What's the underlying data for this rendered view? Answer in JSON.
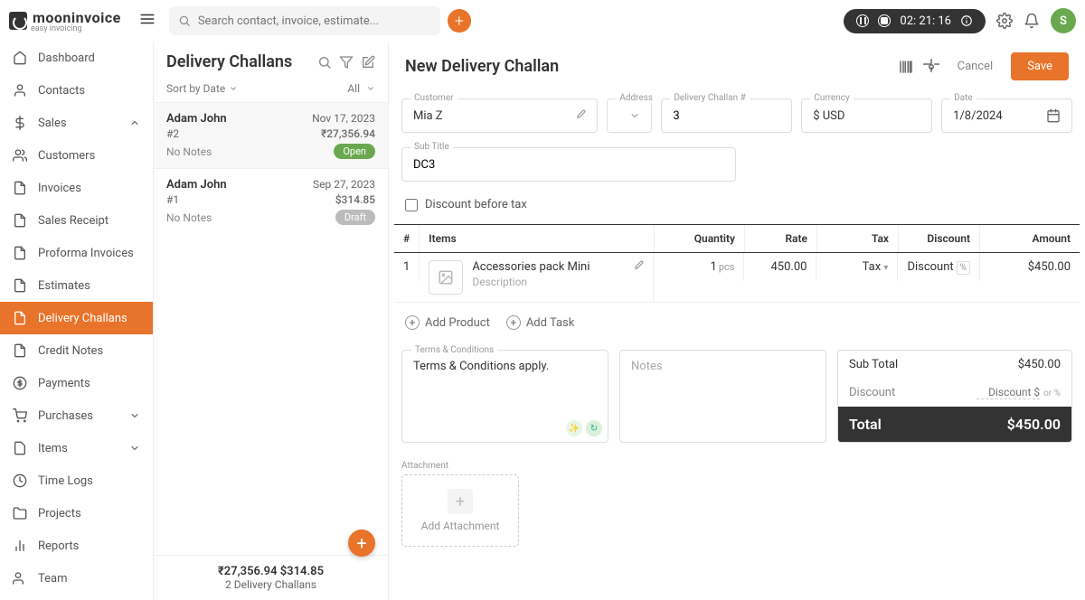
{
  "topbar": {
    "logo": "mooninvoice",
    "logo_sub": "easy invoicing",
    "search_placeholder": "Search contact, invoice, estimate...",
    "timer": "02: 21: 16",
    "avatar": "S"
  },
  "sidebar": {
    "items": [
      {
        "label": "Dashboard"
      },
      {
        "label": "Contacts"
      },
      {
        "label": "Sales",
        "expandable": true,
        "expanded": true
      },
      {
        "label": "Customers"
      },
      {
        "label": "Invoices"
      },
      {
        "label": "Sales Receipt"
      },
      {
        "label": "Proforma Invoices"
      },
      {
        "label": "Estimates"
      },
      {
        "label": "Delivery Challans",
        "active": true
      },
      {
        "label": "Credit Notes"
      },
      {
        "label": "Payments"
      },
      {
        "label": "Purchases",
        "expandable": true
      },
      {
        "label": "Items",
        "expandable": true
      },
      {
        "label": "Time Logs"
      },
      {
        "label": "Projects"
      },
      {
        "label": "Reports"
      },
      {
        "label": "Team"
      }
    ]
  },
  "list": {
    "title": "Delivery Challans",
    "sort_label": "Sort by Date",
    "filter_label": "All",
    "items": [
      {
        "name": "Adam John",
        "date": "Nov 17, 2023",
        "num": "#2",
        "amount": "₹27,356.94",
        "notes": "No Notes",
        "status": "Open",
        "status_cls": "open"
      },
      {
        "name": "Adam John",
        "date": "Sep 27, 2023",
        "num": "#1",
        "amount": "$314.85",
        "notes": "No Notes",
        "status": "Draft",
        "status_cls": "draft"
      }
    ],
    "footer_amounts": "₹27,356.94  $314.85",
    "footer_count": "2 Delivery Challans"
  },
  "main": {
    "title": "New Delivery Challan",
    "cancel": "Cancel",
    "save": "Save",
    "fields": {
      "customer_lbl": "Customer",
      "customer_val": "Mia Z",
      "address_lbl": "Address",
      "dcnum_lbl": "Delivery Challan #",
      "dcnum_val": "3",
      "currency_lbl": "Currency",
      "currency_val": "$ USD",
      "date_lbl": "Date",
      "date_val": "1/8/2024",
      "subtitle_lbl": "Sub Title",
      "subtitle_val": "DC3"
    },
    "discount_before_tax": "Discount before tax",
    "headers": {
      "idx": "#",
      "items": "Items",
      "qty": "Quantity",
      "rate": "Rate",
      "tax": "Tax",
      "disc": "Discount",
      "amt": "Amount"
    },
    "row": {
      "idx": "1",
      "name": "Accessories pack Mini",
      "desc": "Description",
      "qty": "1",
      "qty_unit": "pcs",
      "rate": "450.00",
      "tax": "Tax",
      "disc": "Discount",
      "disc_pct": "%",
      "amt": "$450.00"
    },
    "add_product": "Add Product",
    "add_task": "Add Task",
    "terms_lbl": "Terms & Conditions",
    "terms_val": "Terms & Conditions apply.",
    "notes_placeholder": "Notes",
    "totals": {
      "sub_lbl": "Sub Total",
      "sub_val": "$450.00",
      "disc_lbl": "Discount",
      "disc_ph": "Discount $",
      "disc_orpct": "or %",
      "total_lbl": "Total",
      "total_val": "$450.00"
    },
    "attach_lbl": "Attachment",
    "attach_add": "Add Attachment"
  }
}
